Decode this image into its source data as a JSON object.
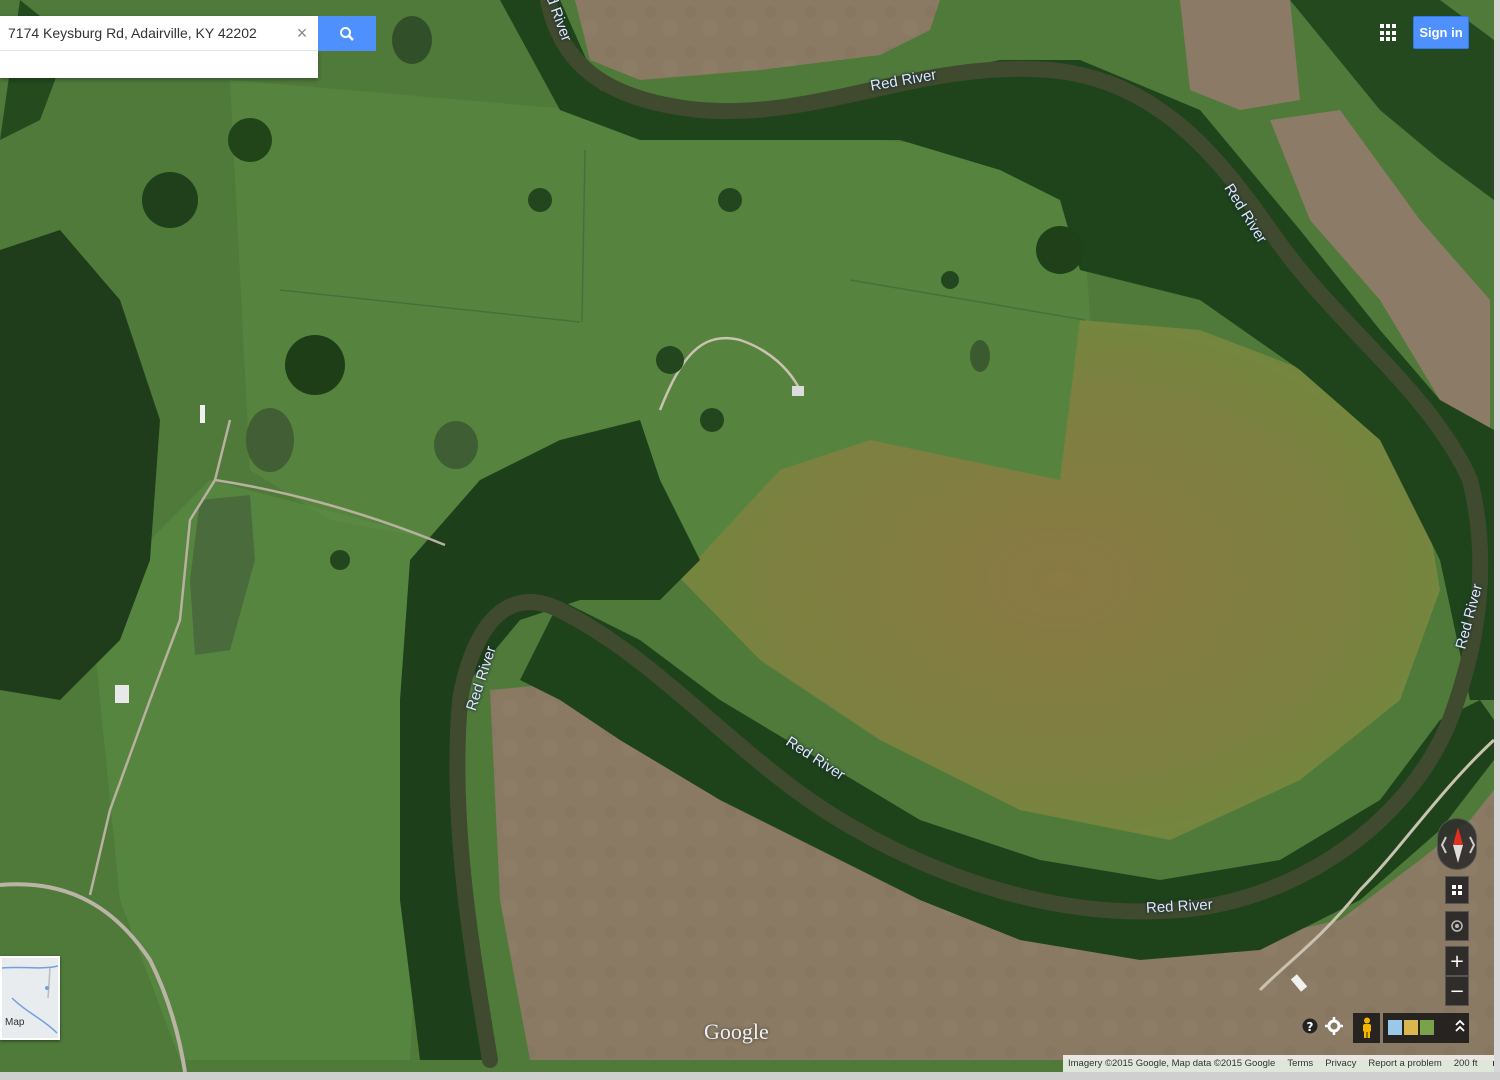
{
  "search": {
    "value": "7174 Keysburg Rd, Adairville, KY 42202",
    "clear_icon": "close-icon",
    "button_icon": "search-icon"
  },
  "header": {
    "apps_icon": "apps-grid-icon",
    "signin_label": "Sign in"
  },
  "map": {
    "mode": "satellite",
    "accent_color": "#4d90fe",
    "river_labels": [
      {
        "text": "d River"
      },
      {
        "text": "Red River"
      },
      {
        "text": "Red River"
      },
      {
        "text": "Red River"
      },
      {
        "text": "Red River"
      },
      {
        "text": "Red River"
      },
      {
        "text": "Red River"
      }
    ]
  },
  "controls": {
    "compass_icon": "compass-icon",
    "tilt_icon": "tilt-icon",
    "location_icon": "my-location-icon",
    "zoom_in": "+",
    "zoom_out": "−",
    "help_icon": "help-icon",
    "settings_icon": "gear-icon",
    "pegman_icon": "pegman-icon",
    "layers_icon": "layers-icon",
    "expand_icon": "chevron-up-icon"
  },
  "minimap": {
    "label": "Map"
  },
  "branding": {
    "logo": "Google"
  },
  "footer": {
    "attribution": "Imagery ©2015 Google, Map data ©2015 Google",
    "terms": "Terms",
    "privacy": "Privacy",
    "report": "Report a problem",
    "scale": "200 ft"
  }
}
